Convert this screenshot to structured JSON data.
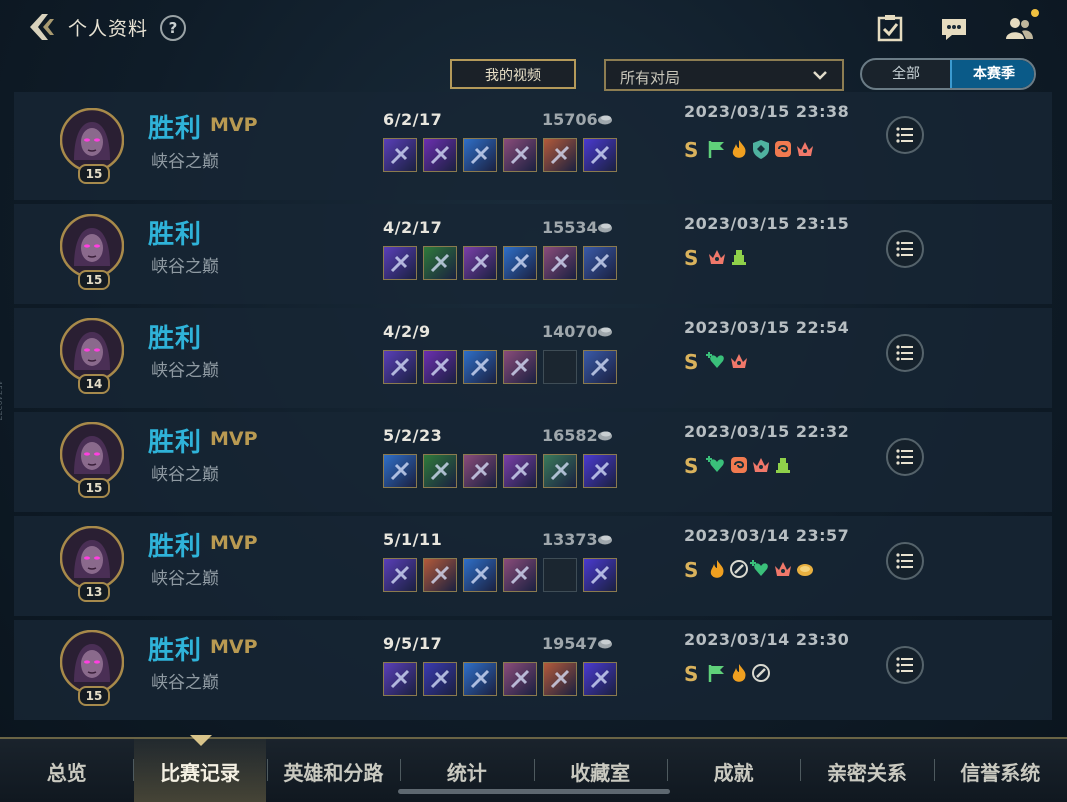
{
  "header": {
    "title": "个人资料",
    "help": "?"
  },
  "filters": {
    "my_video": "我的视频",
    "match_type": "所有对局",
    "season_toggle": [
      "全部",
      "本赛季"
    ],
    "season_selected": "本赛季"
  },
  "matches": [
    {
      "level": "15",
      "result": "胜利",
      "mvp": "MVP",
      "mode": "峡谷之巅",
      "kda": "6/2/17",
      "gold": "15706",
      "time": "2023/03/15 23:38",
      "score": "S",
      "items": [
        "#5a3fb8",
        "#6c2fb0",
        "#2f6fc8",
        "#8a4c7a",
        "#b35a3a",
        "#4a3ad0"
      ],
      "badges": [
        "flag-icon",
        "flame-icon",
        "shield-icon",
        "swirl-icon",
        "crown-icon"
      ]
    },
    {
      "level": "15",
      "result": "胜利",
      "mvp": "",
      "mode": "峡谷之巅",
      "kda": "4/2/17",
      "gold": "15534",
      "time": "2023/03/15 23:15",
      "score": "S",
      "items": [
        "#5a3fb8",
        "#2f7a3a",
        "#7a3fa8",
        "#2f6fc8",
        "#8a4c7a",
        "#3a5aa8"
      ],
      "badges": [
        "crown-icon",
        "tower-icon"
      ]
    },
    {
      "level": "14",
      "result": "胜利",
      "mvp": "",
      "mode": "峡谷之巅",
      "kda": "4/2/9",
      "gold": "14070",
      "time": "2023/03/15 22:54",
      "score": "S",
      "items": [
        "#5a3fb8",
        "#6c2fb0",
        "#2f6fc8",
        "#8a4c7a",
        "",
        "#3a5aa8"
      ],
      "badges": [
        "heal-icon",
        "crown-icon"
      ]
    },
    {
      "level": "15",
      "result": "胜利",
      "mvp": "MVP",
      "mode": "峡谷之巅",
      "kda": "5/2/23",
      "gold": "16582",
      "time": "2023/03/15 22:32",
      "score": "S",
      "items": [
        "#2f6fc8",
        "#2f7a3a",
        "#8a4c7a",
        "#7a3fa8",
        "#3a7a5a",
        "#4a3ad0"
      ],
      "badges": [
        "heal-icon",
        "swirl-icon",
        "crown-icon",
        "tower-icon"
      ]
    },
    {
      "level": "13",
      "result": "胜利",
      "mvp": "MVP",
      "mode": "峡谷之巅",
      "kda": "5/1/11",
      "gold": "13373",
      "time": "2023/03/14 23:57",
      "score": "S",
      "items": [
        "#5a3fb8",
        "#b35a3a",
        "#2f6fc8",
        "#8a4c7a",
        "",
        "#4a3ad0"
      ],
      "badges": [
        "flame-icon",
        "sword-icon",
        "heal-icon",
        "crown-icon",
        "coin-icon"
      ]
    },
    {
      "level": "15",
      "result": "胜利",
      "mvp": "MVP",
      "mode": "峡谷之巅",
      "kda": "9/5/17",
      "gold": "19547",
      "time": "2023/03/14 23:30",
      "score": "S",
      "items": [
        "#5a3fb8",
        "#3a3ab0",
        "#2f6fc8",
        "#8a4c7a",
        "#b35a3a",
        "#4a3ad0"
      ],
      "badges": [
        "flag-icon",
        "flame-icon",
        "sword-icon"
      ]
    }
  ],
  "tabs": [
    "总览",
    "比赛记录",
    "英雄和分路",
    "统计",
    "收藏室",
    "成就",
    "亲密关系",
    "信誉系统"
  ],
  "active_tab": "比赛记录",
  "side_text": "45740377"
}
